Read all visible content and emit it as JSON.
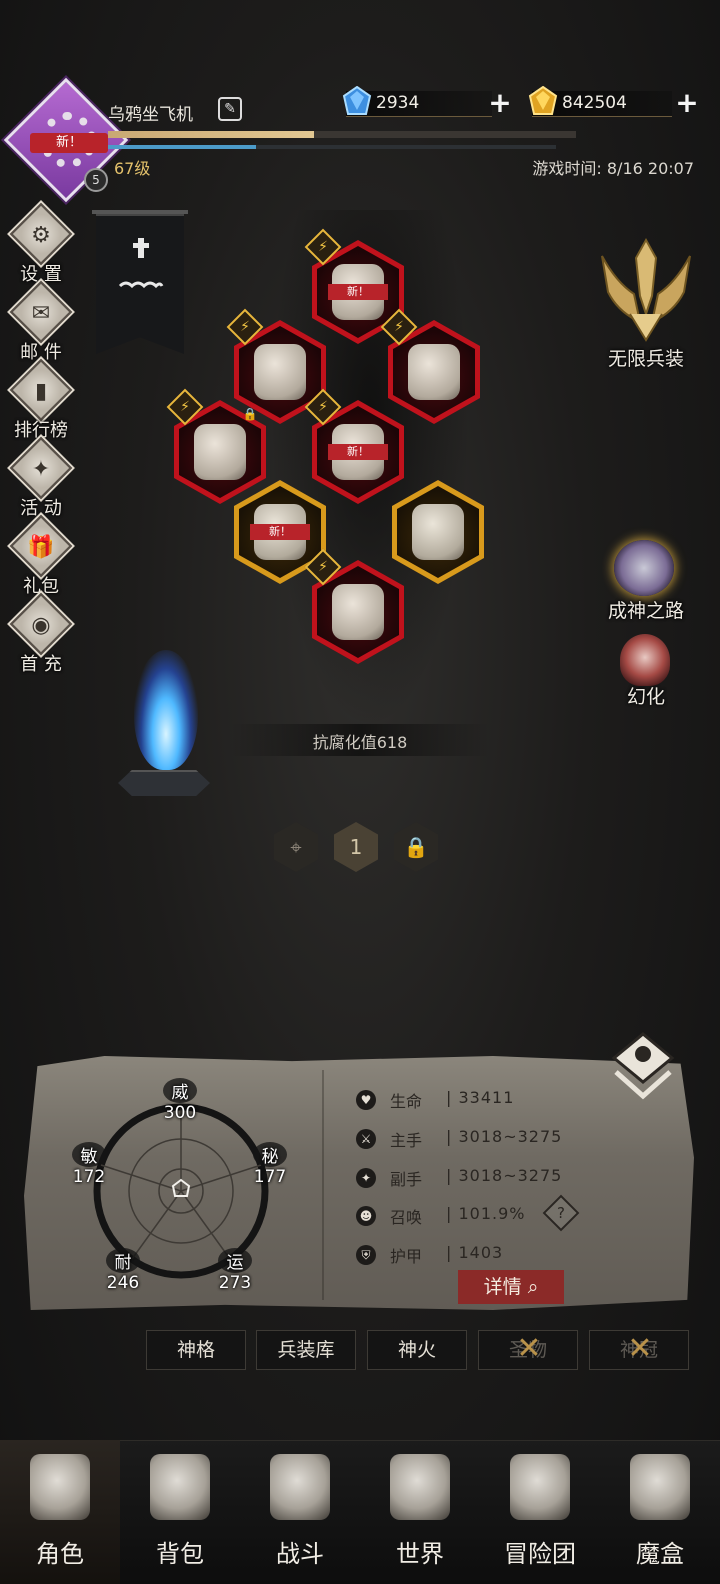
{
  "player": {
    "name": "乌鸦坐飞机",
    "level_label": "67级",
    "rank_badge": "5",
    "avatar_tag": "新！",
    "xp_fraction": 0.44,
    "mp_fraction": 0.33
  },
  "header": {
    "game_time": "游戏时间: 8/16 20:07"
  },
  "currencies": {
    "diamond": {
      "value": "2934",
      "icon": "blue-crystal-icon"
    },
    "gold": {
      "value": "842504",
      "icon": "gold-crystal-icon"
    }
  },
  "left_menu": [
    {
      "label": "设 置",
      "icon": "gear-icon"
    },
    {
      "label": "邮 件",
      "icon": "mail-icon"
    },
    {
      "label": "排行榜",
      "icon": "ranking-icon"
    },
    {
      "label": "活 动",
      "icon": "event-icon"
    },
    {
      "label": "礼包",
      "icon": "gift-icon"
    },
    {
      "label": "首 充",
      "icon": "first-charge-icon"
    }
  ],
  "right_menu": [
    {
      "label": "无限兵装",
      "icon": "infinite-arms-icon"
    },
    {
      "label": "成神之路",
      "icon": "godhood-icon"
    },
    {
      "label": "幻化",
      "icon": "transform-icon"
    }
  ],
  "equipment": {
    "new_tag": "新！",
    "slots": [
      {
        "slot": "head",
        "new": true
      },
      {
        "slot": "shoulder"
      },
      {
        "slot": "necklace"
      },
      {
        "slot": "belt"
      },
      {
        "slot": "chest",
        "new": true
      },
      {
        "slot": "main-hand",
        "new": true
      },
      {
        "slot": "off-hand"
      },
      {
        "slot": "legs"
      }
    ]
  },
  "resist_label": "抗腐化值618",
  "page_selector": {
    "active_page": "1"
  },
  "stats": {
    "radar": {
      "wei": {
        "name": "威",
        "value": "300"
      },
      "mi": {
        "name": "秘",
        "value": "177"
      },
      "yun": {
        "name": "运",
        "value": "273"
      },
      "nai": {
        "name": "耐",
        "value": "246"
      },
      "min": {
        "name": "敏",
        "value": "172"
      }
    },
    "attributes": [
      {
        "name": "生命",
        "value": "| 33411",
        "icon": "heart-icon"
      },
      {
        "name": "主手",
        "value": "| 3018~3275",
        "icon": "main-hand-icon"
      },
      {
        "name": "副手",
        "value": "| 3018~3275",
        "icon": "off-hand-icon"
      },
      {
        "name": "召唤",
        "value": "| 101.9%",
        "icon": "summon-icon"
      },
      {
        "name": "护甲",
        "value": "| 1403",
        "icon": "armor-icon"
      }
    ],
    "detail_button": "详情",
    "help_label": "?"
  },
  "tabs": [
    {
      "label": "神格",
      "locked": false
    },
    {
      "label": "兵装库",
      "locked": false
    },
    {
      "label": "神火",
      "locked": false
    },
    {
      "label": "圣物",
      "locked": true
    },
    {
      "label": "神冠",
      "locked": true
    }
  ],
  "bottom_nav": [
    {
      "label": "角色",
      "icon": "helmet-icon",
      "active": true
    },
    {
      "label": "背包",
      "icon": "backpack-icon"
    },
    {
      "label": "战斗",
      "icon": "sword-shield-icon"
    },
    {
      "label": "世界",
      "icon": "world-map-icon"
    },
    {
      "label": "冒险团",
      "icon": "castle-icon"
    },
    {
      "label": "魔盒",
      "icon": "magic-box-icon"
    }
  ],
  "colors": {
    "accent_gold": "#e3c16b",
    "equip_red": "#c0121c",
    "equip_gold": "#d89a1c",
    "detail_red": "#8b2a28"
  }
}
